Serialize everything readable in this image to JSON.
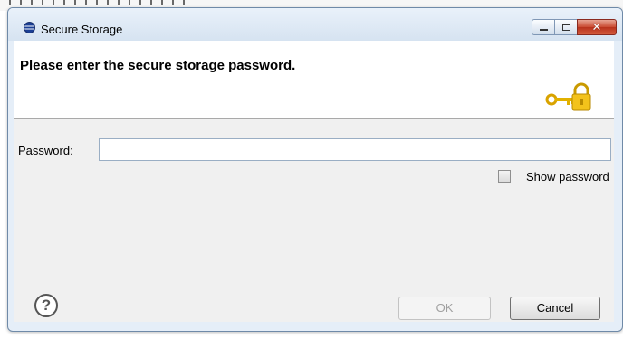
{
  "window": {
    "title": "Secure Storage"
  },
  "controls": {
    "close_glyph": "✕"
  },
  "banner": {
    "message": "Please enter the secure storage password."
  },
  "form": {
    "password_label": "Password:",
    "password_value": "",
    "show_password_label": "Show password",
    "show_password_checked": false
  },
  "buttons": {
    "help_glyph": "?",
    "ok_label": "OK",
    "cancel_label": "Cancel",
    "ok_enabled": false
  },
  "icons": {
    "app": "eclipse-icon",
    "banner": "key-lock-icon",
    "help": "help-icon"
  }
}
